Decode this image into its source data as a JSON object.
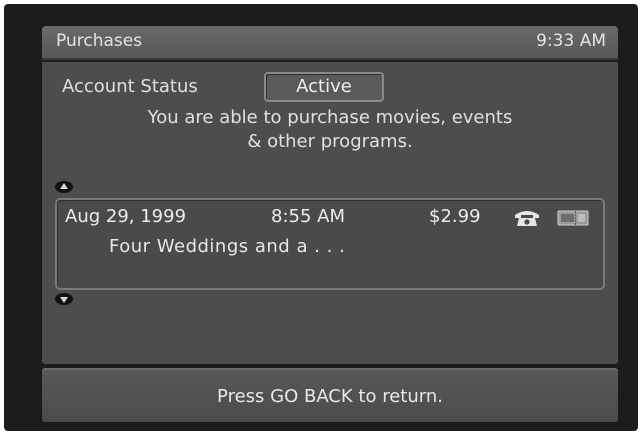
{
  "header": {
    "title": "Purchases",
    "time": "9:33 AM"
  },
  "account": {
    "status_label": "Account Status",
    "status_value": "Active",
    "message_line1": "You are able to purchase movies, events",
    "message_line2": "& other programs."
  },
  "purchases": [
    {
      "date": "Aug 29, 1999",
      "time": "8:55 AM",
      "price": "$2.99",
      "title": "Four Weddings and a . . .",
      "icons": [
        "phone-icon",
        "ticket-icon"
      ]
    }
  ],
  "footer": {
    "instruction": "Press GO BACK to return."
  },
  "colors": {
    "background": "#1c1c1c",
    "panel": "#4d4d4d",
    "header": "#626262",
    "text": "#e4e4e4"
  }
}
